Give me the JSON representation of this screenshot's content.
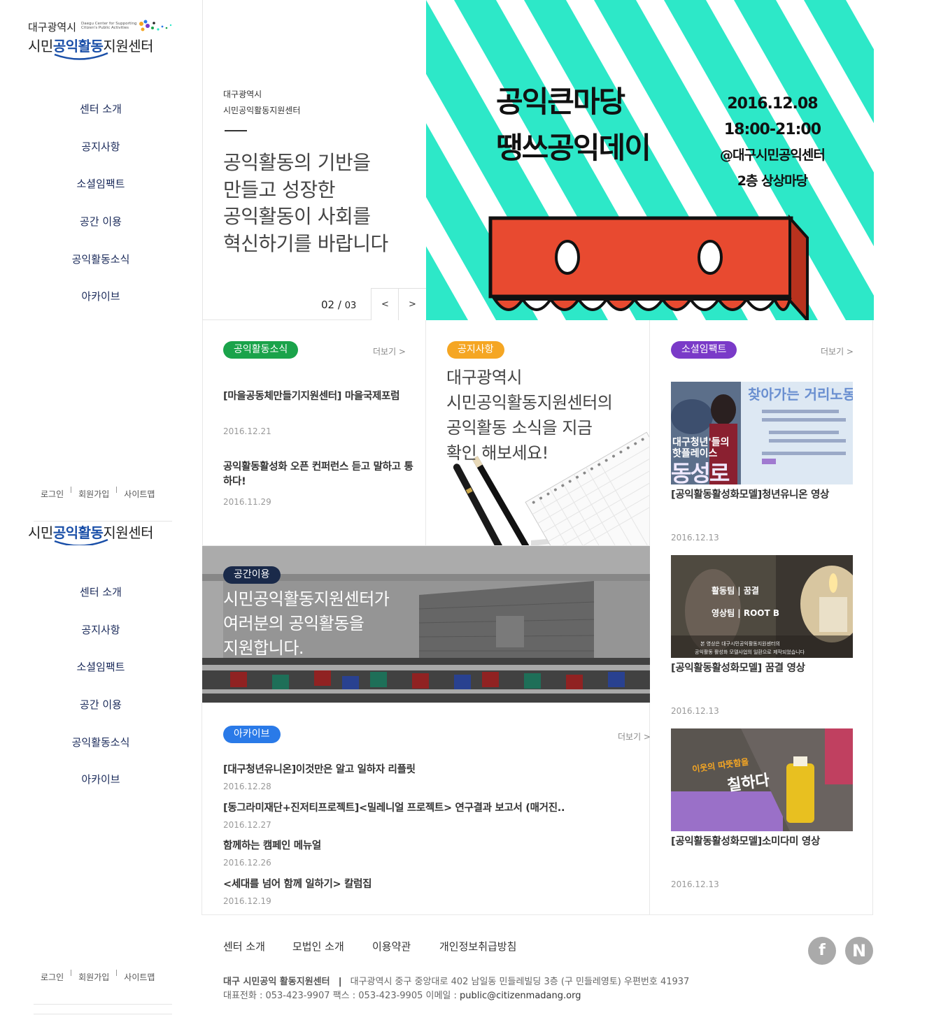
{
  "logo": {
    "line1": "대구광역시",
    "line1_small": "Daegu Center for Supporting Citizen's Public Activities",
    "line2_pre": "시민",
    "line2_bold": "공익활동",
    "line2_post": "지원센터"
  },
  "nav": {
    "items": [
      {
        "label": "센터 소개"
      },
      {
        "label": "공지사항"
      },
      {
        "label": "소셜임팩트"
      },
      {
        "label": "공간 이용"
      },
      {
        "label": "공익활동소식"
      },
      {
        "label": "아카이브"
      }
    ]
  },
  "util": {
    "login": "로그인",
    "join": "회원가입",
    "sitemap": "사이트맵"
  },
  "hero": {
    "org_line1": "대구광역시",
    "org_line2": "시민공익활동지원센터",
    "slogan": [
      "공익활동의 기반을",
      "만들고 성장한",
      "공익활동이 사회를",
      "혁신하기를 바랍니다"
    ],
    "page_current": "02",
    "page_sep": "/",
    "page_total": "03",
    "prev": "<",
    "next": ">",
    "banner": {
      "title1": "공익큰마당",
      "title2": "땡쓰공익데이",
      "date": "2016.12.08",
      "time": "18:00-21:00",
      "place1": "@대구시민공익센터",
      "place2": "2층 상상마당",
      "stripe_color": "#2de8c8",
      "awning_color": "#e84a30"
    }
  },
  "news": {
    "badge": "공익활동소식",
    "badge_color": "#1aa34a",
    "more": "더보기 >",
    "items": [
      {
        "title": "[마을공동체만들기지원센터] 마을국제포럼",
        "date": "2016.12.21"
      },
      {
        "title": "공익활동활성화 오픈 컨퍼런스 듣고 말하고 통하다!",
        "date": "2016.11.29"
      }
    ]
  },
  "notice": {
    "badge": "공지사항",
    "badge_color": "#f5a623",
    "text": [
      "대구광역시",
      "시민공익활동지원센터의",
      "공익활동 소식을 지금",
      "확인 해보세요!"
    ]
  },
  "space": {
    "badge": "공간이용",
    "badge_color": "#1a2a4a",
    "text": [
      "시민공익활동지원센터가",
      "여러분의 공익활동을",
      "지원합니다."
    ]
  },
  "archive": {
    "badge": "아카이브",
    "badge_color": "#2a7ae8",
    "more": "더보기 >",
    "items": [
      {
        "title": "[대구청년유니온]이것만은 알고 일하자 리플릿",
        "date": "2016.12.28"
      },
      {
        "title": "[동그라미재단+진저티프로젝트]<밀레니얼 프로젝트> 연구결과 보고서 (매거진..",
        "date": "2016.12.27"
      },
      {
        "title": "함께하는 캠페인 메뉴얼",
        "date": "2016.12.26"
      },
      {
        "title": "<세대를 넘어 함께 일하기> 칼럼집",
        "date": "2016.12.19"
      }
    ]
  },
  "social": {
    "badge": "소셜임팩트",
    "badge_color": "#7a3ac8",
    "more": "더보기 >",
    "items": [
      {
        "title": "[공익활동활성화모델]청년유니온 영상",
        "date": "2016.12.13",
        "thumb_text1": "찾아가는 거리노동상",
        "thumb_text2": "대구청년'들의",
        "thumb_text3": "핫플레이스",
        "thumb_text4": "동성로"
      },
      {
        "title": "[공익활동활성화모델] 꿈결 영상",
        "date": "2016.12.13",
        "thumb_text1": "활동팀 | 꿈결",
        "thumb_text2": "영상팀 | ROOT B",
        "thumb_text3": "본 영상은 대구시민공익활동지원센터의",
        "thumb_text4": "공익활동 활성화 모델사업의 일환으로 제작되었습니다"
      },
      {
        "title": "[공익활동활성화모델]소미다미 영상",
        "date": "2016.12.13",
        "thumb_text1": "이웃의 따뜻함을",
        "thumb_text2": "칠하다"
      }
    ]
  },
  "footer": {
    "links": [
      "센터 소개",
      "모법인 소개",
      "이용약관",
      "개인정보취급방침"
    ],
    "org": "대구 시민공익 활동지원센터",
    "sep": "|",
    "address": "대구광역시 중구 중앙대로 402 남일동 민들레빌딩 3층 (구 민들레영토) 우편번호 41937",
    "contact_prefix": "대표전화 : 053-423-9907 팩스 : 053-423-9905 이메일 : ",
    "email": "public@citizenmadang.org",
    "facebook": "f",
    "naver": "N"
  }
}
